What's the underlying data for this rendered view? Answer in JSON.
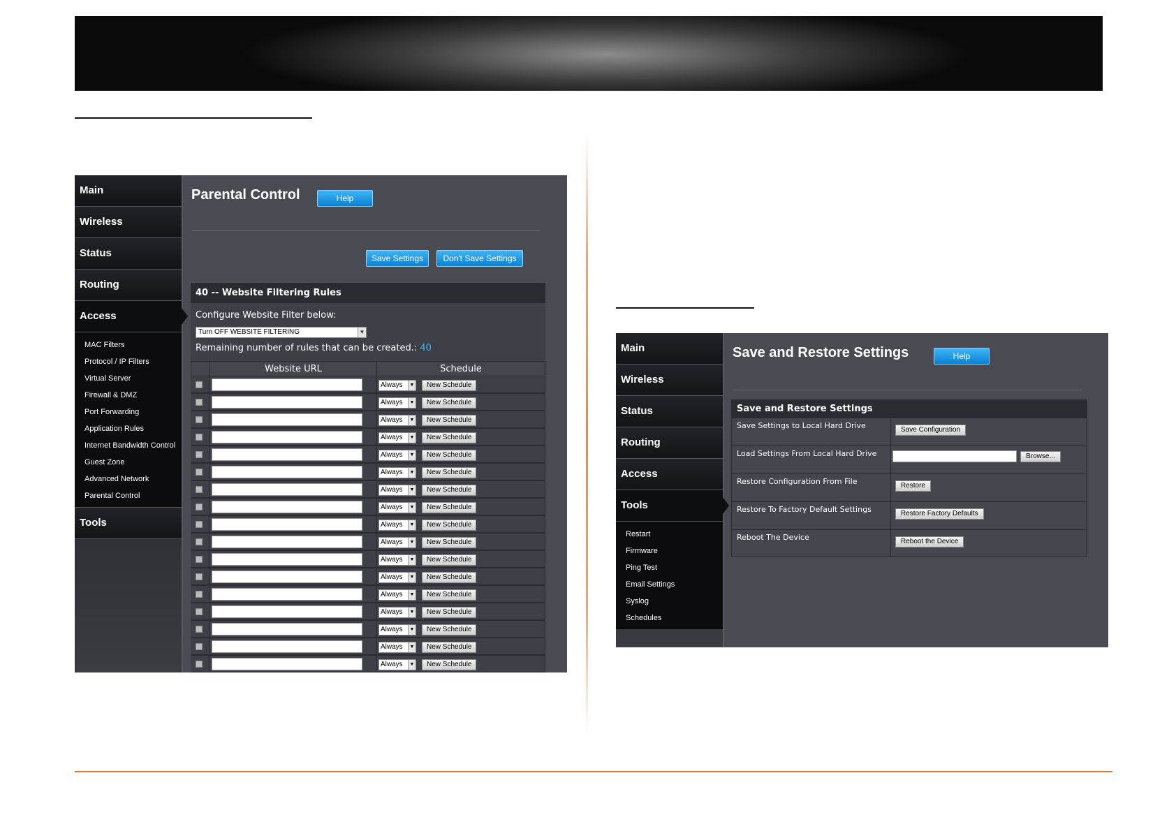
{
  "left_panel": {
    "sidebar": {
      "main_items": [
        "Main",
        "Wireless",
        "Status",
        "Routing"
      ],
      "active_item": "Access",
      "sub_items": [
        "MAC Filters",
        "Protocol / IP Filters",
        "Virtual Server",
        "Firewall & DMZ",
        "Port Forwarding",
        "Application Rules",
        "Internet Bandwidth Control",
        "Guest Zone",
        "Advanced Network",
        "Parental Control"
      ],
      "bottom_item": "Tools"
    },
    "title": "Parental Control",
    "help_label": "Help",
    "save_label": "Save Settings",
    "dont_save_label": "Don't Save Settings",
    "rules_header": "40 -- Website Filtering Rules",
    "configure_label": "Configure Website Filter below:",
    "filter_select_value": "Turn OFF WEBSITE FILTERING",
    "remaining_label": "Remaining number of rules that can be created.:",
    "remaining_count": "40",
    "columns": [
      "Website URL",
      "Schedule"
    ],
    "row_schedule_value": "Always",
    "row_button_label": "New Schedule",
    "row_count": 17
  },
  "right_panel": {
    "sidebar": {
      "main_items": [
        "Main",
        "Wireless",
        "Status",
        "Routing",
        "Access"
      ],
      "active_item": "Tools",
      "sub_items": [
        "Restart",
        "Firmware",
        "Ping Test",
        "Email Settings",
        "Syslog",
        "Schedules"
      ]
    },
    "title": "Save and Restore Settings",
    "help_label": "Help",
    "box_header": "Save and Restore Settings",
    "rows": [
      {
        "label": "Save Settings to Local Hard Drive",
        "button": "Save Configuration"
      },
      {
        "label": "Load Settings From Local Hard Drive",
        "button": "Browse..."
      },
      {
        "label": "Restore Configuration From File",
        "button": "Restore"
      },
      {
        "label": "Restore To Factory Default Settings",
        "button": "Restore Factory Defaults"
      },
      {
        "label": "Reboot The Device",
        "button": "Reboot the Device"
      }
    ]
  }
}
